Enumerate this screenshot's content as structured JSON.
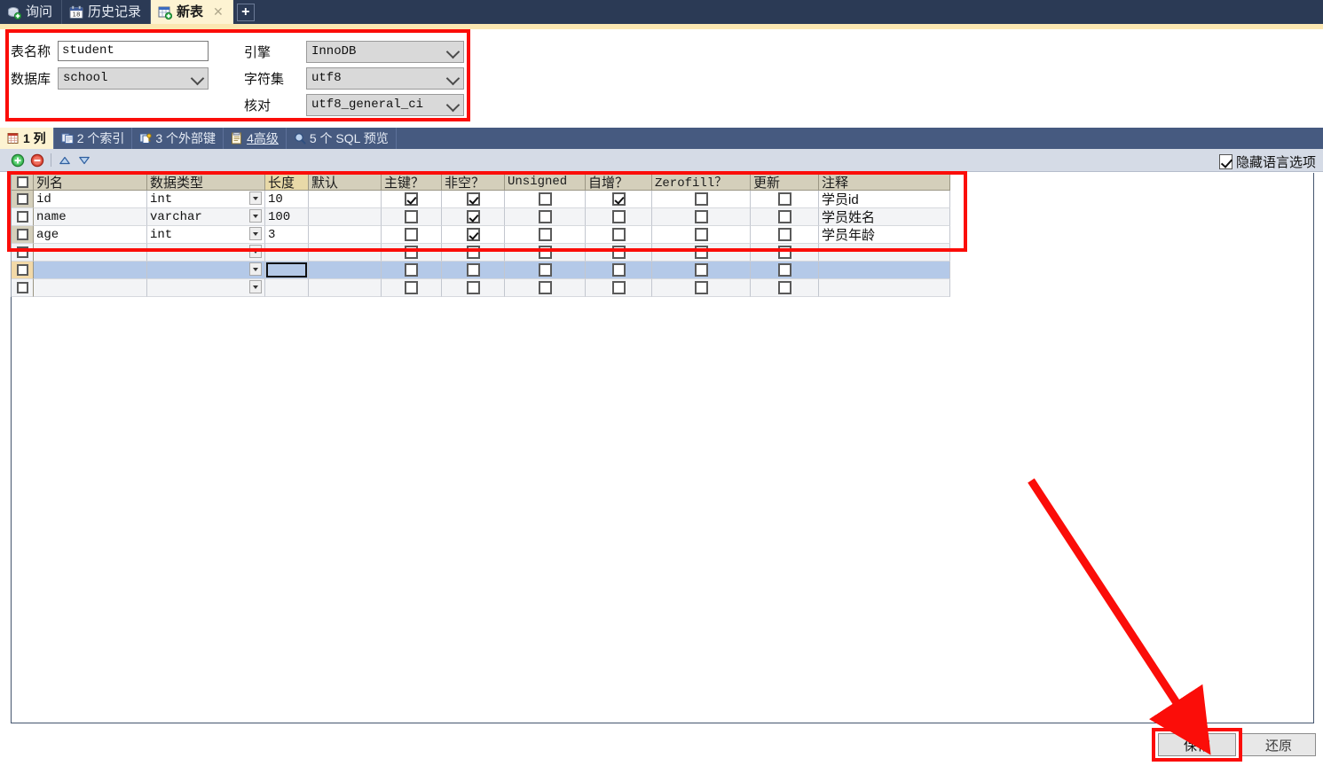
{
  "window": {
    "tabs": [
      {
        "label": "询问",
        "icon": "query-icon",
        "active": false,
        "closable": false
      },
      {
        "label": "历史记录",
        "icon": "calendar-icon",
        "active": false,
        "closable": false
      },
      {
        "label": "新表",
        "icon": "new-table-icon",
        "active": true,
        "closable": true
      }
    ],
    "add_tab_label": "+"
  },
  "form": {
    "table_name_label": "表名称",
    "table_name_value": "student",
    "database_label": "数据库",
    "database_value": "school",
    "engine_label": "引擎",
    "engine_value": "InnoDB",
    "charset_label": "字符集",
    "charset_value": "utf8",
    "collation_label": "核对",
    "collation_value": "utf8_general_ci"
  },
  "subtabs": [
    {
      "label": "1 列",
      "icon": "columns-icon",
      "active": true
    },
    {
      "label": "2 个索引",
      "icon": "index-icon",
      "active": false
    },
    {
      "label": "3 个外部键",
      "icon": "foreign-key-icon",
      "active": false
    },
    {
      "label": "4高级",
      "icon": "advanced-icon",
      "active": false
    },
    {
      "label": "5 个 SQL 预览",
      "icon": "sql-preview-icon",
      "active": false
    }
  ],
  "toolbar": {
    "add_label": "add-row",
    "remove_label": "remove-row",
    "move_up_label": "move-up",
    "move_down_label": "move-down"
  },
  "hide_language_option": {
    "label": "隐藏语言选项",
    "checked": true
  },
  "grid": {
    "headers": [
      "列名",
      "数据类型",
      "长度",
      "默认",
      "主键？",
      "非空？",
      "Unsigned",
      "自增？",
      "Zerofill？",
      "更新",
      "注释"
    ],
    "highlighted_header": "长度",
    "rows": [
      {
        "name": "id",
        "datatype": "int",
        "length": "10",
        "default": "",
        "primary_key": true,
        "not_null": true,
        "unsigned": false,
        "auto_increment": true,
        "zerofill": false,
        "update": false,
        "comment": "学员id"
      },
      {
        "name": "name",
        "datatype": "varchar",
        "length": "100",
        "default": "",
        "primary_key": false,
        "not_null": true,
        "unsigned": false,
        "auto_increment": false,
        "zerofill": false,
        "update": false,
        "comment": "学员姓名"
      },
      {
        "name": "age",
        "datatype": "int",
        "length": "3",
        "default": "",
        "primary_key": false,
        "not_null": true,
        "unsigned": false,
        "auto_increment": false,
        "zerofill": false,
        "update": false,
        "comment": "学员年龄"
      },
      {
        "name": "",
        "datatype": "",
        "length": "",
        "default": "",
        "primary_key": false,
        "not_null": false,
        "unsigned": false,
        "auto_increment": false,
        "zerofill": false,
        "update": false,
        "comment": "",
        "empty": true
      },
      {
        "name": "",
        "datatype": "",
        "length": "",
        "default": "",
        "primary_key": false,
        "not_null": false,
        "unsigned": false,
        "auto_increment": false,
        "zerofill": false,
        "update": false,
        "comment": "",
        "empty": true,
        "selected": true
      },
      {
        "name": "",
        "datatype": "",
        "length": "",
        "default": "",
        "primary_key": false,
        "not_null": false,
        "unsigned": false,
        "auto_increment": false,
        "zerofill": false,
        "update": false,
        "comment": "",
        "empty": true
      }
    ]
  },
  "footer": {
    "save_label": "保存",
    "revert_label": "还原"
  },
  "annotations": {
    "color": "#fb0d09",
    "boxes": [
      {
        "name": "form-panel-highlight"
      },
      {
        "name": "grid-rows-highlight"
      },
      {
        "name": "save-button-highlight"
      }
    ],
    "arrow": {
      "name": "save-button-arrow"
    }
  }
}
